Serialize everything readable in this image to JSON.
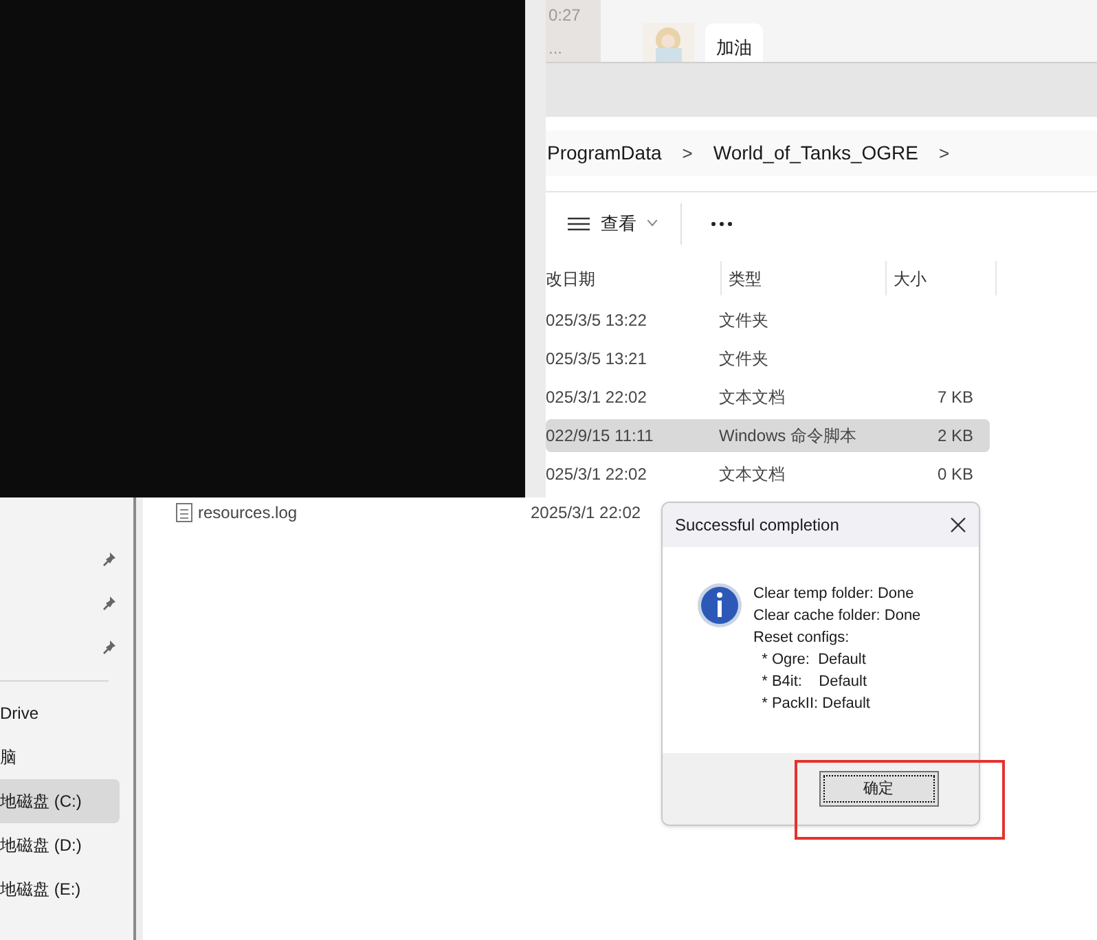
{
  "chat": {
    "time": "0:27",
    "preview": "...",
    "message": "加油"
  },
  "explorer": {
    "breadcrumb": [
      "ProgramData",
      "World_of_Tanks_OGRE"
    ],
    "separator": ">",
    "toolbar": {
      "view": "查看"
    },
    "columns": [
      "改日期",
      "类型",
      "大小"
    ],
    "rows": [
      {
        "date": "025/3/5 13:22",
        "type": "文件夹",
        "selected": false
      },
      {
        "date": "025/3/5 13:21",
        "type": "文件夹",
        "selected": false
      },
      {
        "date": "025/3/1 22:02",
        "type": "文本文档",
        "size": "7 KB",
        "selected": false
      },
      {
        "date": "022/9/15 11:11",
        "type": "Windows 命令脚本",
        "size": "2 KB",
        "selected": true
      },
      {
        "date": "025/3/1 22:02",
        "type": "文本文档",
        "size": "0 KB",
        "selected": false
      },
      {
        "name": "resources.log",
        "date": "2025/3/1 22:02",
        "selected": false
      }
    ],
    "sidebar": [
      {
        "kind": "pinned"
      },
      {
        "kind": "pinned"
      },
      {
        "kind": "pinned"
      },
      {
        "kind": "divider"
      },
      {
        "kind": "item",
        "label": "Drive",
        "selected": false
      },
      {
        "kind": "item",
        "label": "脑",
        "selected": false
      },
      {
        "kind": "item",
        "label": "地磁盘 (C:)",
        "selected": true
      },
      {
        "kind": "item",
        "label": "地磁盘 (D:)",
        "selected": false
      },
      {
        "kind": "item",
        "label": "地磁盘 (E:)",
        "selected": false
      }
    ]
  },
  "dialog": {
    "title": "Successful completion",
    "lines": [
      "Clear temp folder: Done",
      "Clear cache folder: Done",
      "Reset configs:",
      "  * Ogre:  Default",
      "  * B4it:    Default",
      "  * PackII: Default"
    ],
    "button": "确定"
  }
}
